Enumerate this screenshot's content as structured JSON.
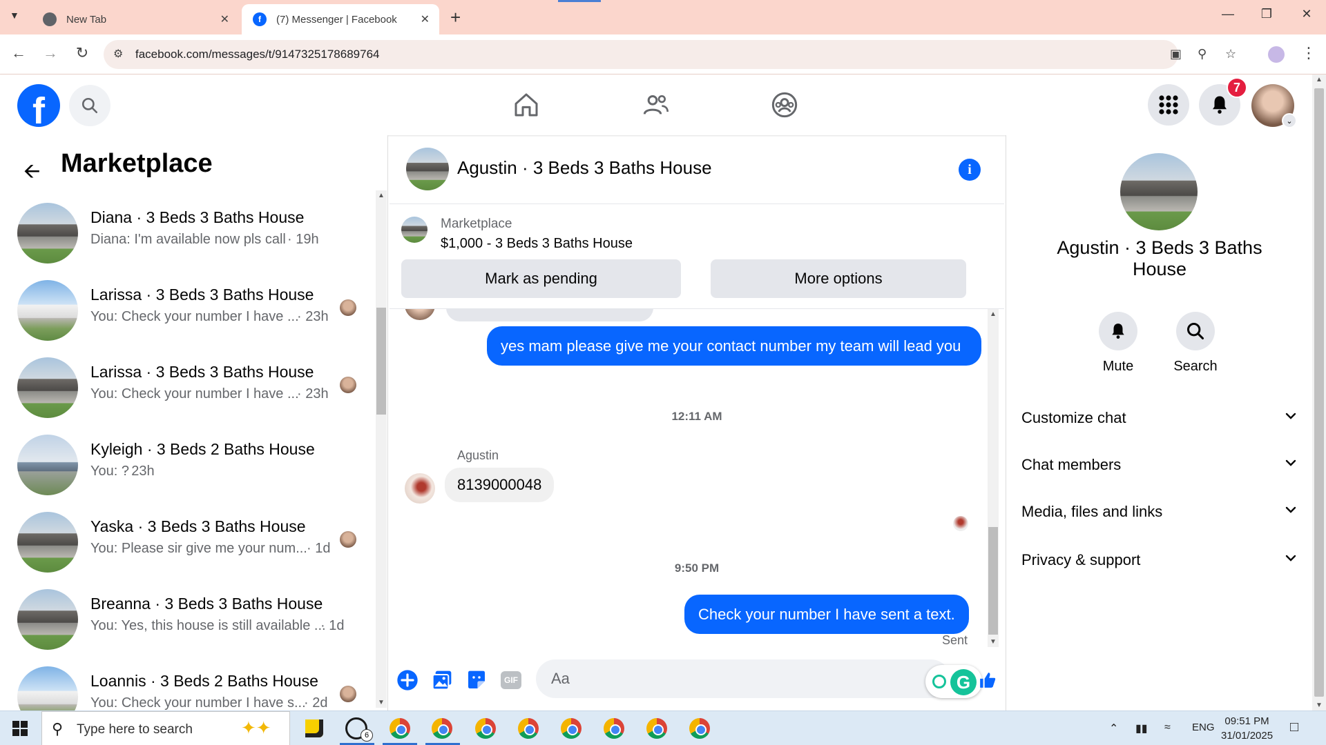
{
  "browser": {
    "tabs": [
      {
        "title": "New Tab",
        "active": false
      },
      {
        "title": "(7) Messenger | Facebook",
        "active": true
      }
    ],
    "url": "facebook.com/messages/t/9147325178689764"
  },
  "header": {
    "notification_count": "7"
  },
  "left_panel": {
    "title": "Marketplace",
    "chats": [
      {
        "name": "Diana · 3 Beds 3 Baths House",
        "preview": "Diana: I'm available now pls call",
        "time": "· 19h"
      },
      {
        "name": "Larissa · 3 Beds 3 Baths House",
        "preview": "You: Check your number I have ...",
        "time": "· 23h"
      },
      {
        "name": "Larissa · 3 Beds 3 Baths House",
        "preview": "You: Check your number I have ...",
        "time": "· 23h"
      },
      {
        "name": "Kyleigh · 3 Beds 2 Baths House",
        "preview": "You: ?",
        "time": "· 23h"
      },
      {
        "name": "Yaska · 3 Beds 3 Baths House",
        "preview": "You: Please sir give me your num...",
        "time": "· 1d"
      },
      {
        "name": "Breanna · 3 Beds 3 Baths House",
        "preview": "You: Yes, this house is still available ...",
        "time": "· 1d"
      },
      {
        "name": "Loannis · 3 Beds 2 Baths House",
        "preview": "You: Check your number I have s...",
        "time": "· 2d"
      }
    ]
  },
  "conversation": {
    "title": "Agustin · 3 Beds 3 Baths House",
    "listing": {
      "label": "Marketplace",
      "price_title": "$1,000 - 3 Beds 3 Baths House",
      "mark_pending": "Mark as pending",
      "more_options": "More options"
    },
    "messages": {
      "out1": "yes mam please give me your contact number my team will lead you",
      "ts1": "12:11 AM",
      "sender": "Agustin",
      "in1": "8139000048",
      "ts2": "9:50 PM",
      "out2": "Check your number I have sent a text.",
      "status": "Sent"
    },
    "input_placeholder": "Aa"
  },
  "right_panel": {
    "name": "Agustin · 3 Beds 3 Baths House",
    "mute": "Mute",
    "search": "Search",
    "sections": [
      "Customize chat",
      "Chat members",
      "Media, files and links",
      "Privacy & support"
    ]
  },
  "taskbar": {
    "search_placeholder": "Type here to search",
    "whatsapp_badge": "6",
    "lang": "ENG",
    "time": "09:51 PM",
    "date": "31/01/2025"
  },
  "colors": {
    "brand": "#0866ff",
    "tabbar": "#fbd6cc"
  }
}
